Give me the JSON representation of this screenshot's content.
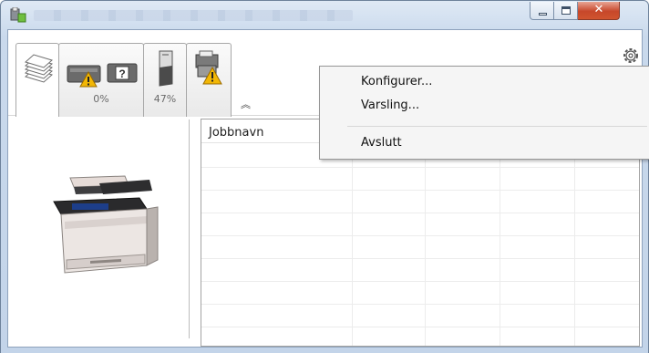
{
  "window": {
    "title": ""
  },
  "tabs": [
    {
      "name": "jobs",
      "percent": ""
    },
    {
      "name": "toner-warning",
      "percent": "0%"
    },
    {
      "name": "paper",
      "percent": "47%"
    },
    {
      "name": "device-warning",
      "percent": ""
    }
  ],
  "job_table": {
    "columns": [
      "Jobbnavn",
      "",
      "",
      "",
      ""
    ]
  },
  "context_menu": {
    "items": [
      "Konfigurer...",
      "Varsling...",
      "Avslutt"
    ]
  },
  "icons": {
    "app": "printer-app-icon",
    "gear": "gear-icon",
    "chevron": "chevron-up-icon",
    "warning": "warning-icon"
  },
  "colors": {
    "warning": "#f2b705",
    "close_button": "#c7472a",
    "window_frame": "#c9d9ec"
  }
}
